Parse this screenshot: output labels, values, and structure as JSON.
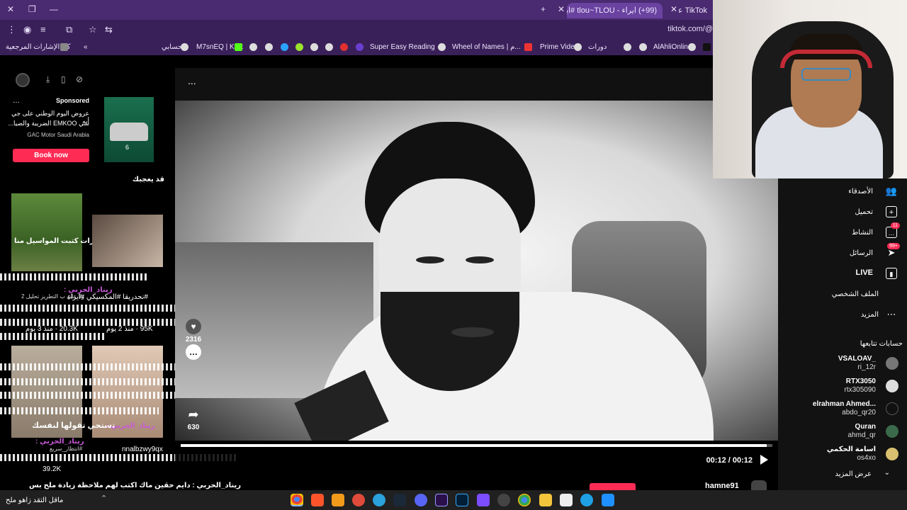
{
  "browser": {
    "tabs": [
      {
        "label": "(99+) ايراء - tlou~TLOU #ايراء #2…",
        "active": true
      },
      {
        "label": "TikTok على ",
        "active": false
      }
    ],
    "url": "tiktok.com/@",
    "bookmarks": {
      "folder": "كل الإشارات المرجعية",
      "items": [
        "حسابي",
        "M7snEQ | Kick",
        "Super Easy Reading",
        "Wheel of Names | م...",
        "Prime Video",
        "دورات",
        "AlAhliOnline"
      ]
    }
  },
  "left_panel": {
    "ad": {
      "sponsored": "Sponsored",
      "line1": "عروض اليوم الوطني على جي أيه",
      "line2": "سي EMKOO الضريبة والصيا...",
      "advertiser": "GAC Motor Saudi Arabia",
      "cta": "Book now"
    },
    "section_title": "قد يعجبك",
    "overlay_texts": {
      "thumb1_caption": "د.شفرات كتبت المواسيل منا",
      "tags": "#نحدريقا #المكسيكي #ايراء",
      "tags2": "ولا علي ب التطريز تحليل 2",
      "stats1": "20.3K · منذ 3 يوم",
      "stats2": "95K · منذ 2 يوم",
      "chat_name1": "ريناد_الحربي :",
      "chat_msg": "تستحي تقولها لنفسك",
      "chat_name2": "ريناد_الحربي :",
      "handle": "nnalbzwy9qx",
      "stats3": "39.2K",
      "hashtag_small": "#انتظار_سريع",
      "bottom_chat": "ريناد_الحربي : دايم حقين ماك اكتب لهم ملاحظة زيادة ملح بس",
      "bottom_chat2": "ماقل التقد زاهو ملح"
    }
  },
  "video": {
    "likes": "2316",
    "shares": "630",
    "time": "00:12 / 00:12",
    "progress": 0.99,
    "more": "..."
  },
  "right_nav": {
    "items": [
      {
        "label": "الأصدقاء",
        "icon": "friends-icon"
      },
      {
        "label": "تحميل",
        "icon": "upload-icon"
      },
      {
        "label": "النشاط",
        "icon": "activity-icon",
        "badge": "11"
      },
      {
        "label": "الرسائل",
        "icon": "messages-icon",
        "badge": "99+"
      },
      {
        "label": "LIVE",
        "icon": "live-icon"
      },
      {
        "label": "الملف الشخصي",
        "icon": "profile-icon"
      },
      {
        "label": "المزيد",
        "icon": "more-icon"
      }
    ],
    "following_title": "حسابات تتابعها",
    "accounts": [
      {
        "name": "VSALOAV_",
        "handle": "ri_12r"
      },
      {
        "name": "RTX3050",
        "handle": "rtx305090"
      },
      {
        "name": "elrahman Ahmed...",
        "handle": "abdo_qr20"
      },
      {
        "name": "Quran",
        "handle": "ahmd_qr"
      },
      {
        "name": "اسامة الحكمي",
        "handle": "os4xo"
      }
    ],
    "see_more": "عرض المزيد"
  },
  "bottom_user": "hamne91",
  "colors": {
    "tiktok_red": "#fe2c55",
    "browser_purple": "#4a2a70"
  }
}
